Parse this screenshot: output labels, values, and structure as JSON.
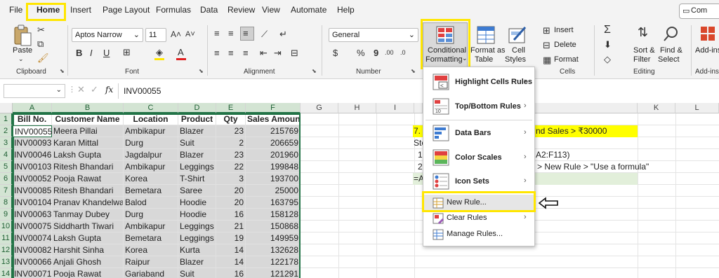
{
  "tabs": [
    "File",
    "Home",
    "Insert",
    "Page Layout",
    "Formulas",
    "Data",
    "Review",
    "View",
    "Automate",
    "Help"
  ],
  "active_tab": "Home",
  "comments_button": "Com",
  "ribbon": {
    "clipboard": {
      "paste": "Paste",
      "group": "Clipboard"
    },
    "font": {
      "name": "Aptos Narrow",
      "size": "11",
      "group": "Font"
    },
    "alignment": {
      "group": "Alignment"
    },
    "number": {
      "format": "General",
      "group": "Number"
    },
    "styles": {
      "conditional_formatting_line1": "Conditional",
      "conditional_formatting_line2": "Formatting",
      "format_as_table_line1": "Format as",
      "format_as_table_line2": "Table",
      "cell_styles_line1": "Cell",
      "cell_styles_line2": "Styles"
    },
    "cells": {
      "insert": "Insert",
      "delete": "Delete",
      "format": "Format",
      "group": "Cells"
    },
    "editing": {
      "sort_filter_line1": "Sort &",
      "sort_filter_line2": "Filter",
      "find_select_line1": "Find &",
      "find_select_line2": "Select",
      "group": "Editing"
    },
    "addins": {
      "label": "Add-ins",
      "group": "Add-ins"
    }
  },
  "formula_bar": {
    "name_box": "",
    "fx": "fx",
    "content": "INV00055"
  },
  "columns": [
    "A",
    "B",
    "C",
    "D",
    "E",
    "F",
    "G",
    "H",
    "I",
    "J",
    "K",
    "L"
  ],
  "rows": [
    "1",
    "2",
    "3",
    "4",
    "5",
    "6",
    "7",
    "8",
    "9",
    "10",
    "11",
    "12",
    "13",
    "14"
  ],
  "table": {
    "headers": [
      "Bill No.",
      "Customer Name",
      "Location",
      "Product",
      "Qty",
      "Sales Amount"
    ],
    "rows": [
      [
        "INV00055",
        "Meera Pillai",
        "Ambikapur",
        "Blazer",
        "23",
        "215769"
      ],
      [
        "INV00093",
        "Karan Mittal",
        "Durg",
        "Suit",
        "2",
        "206659"
      ],
      [
        "INV00046",
        "Laksh Gupta",
        "Jagdalpur",
        "Blazer",
        "23",
        "201960"
      ],
      [
        "INV00103",
        "Ritesh Bhandari",
        "Ambikapur",
        "Leggings",
        "22",
        "199848"
      ],
      [
        "INV00052",
        "Pooja Rawat",
        "Korea",
        "T-Shirt",
        "3",
        "193700"
      ],
      [
        "INV00085",
        "Ritesh Bhandari",
        "Bemetara",
        "Saree",
        "20",
        "25000"
      ],
      [
        "INV00104",
        "Pranav Khandelwal",
        "Balod",
        "Hoodie",
        "20",
        "163795"
      ],
      [
        "INV00063",
        "Tanmay Dubey",
        "Durg",
        "Hoodie",
        "16",
        "158128"
      ],
      [
        "INV00075",
        "Siddharth Tiwari",
        "Ambikapur",
        "Leggings",
        "21",
        "150868"
      ],
      [
        "INV00074",
        "Laksh Gupta",
        "Bemetara",
        "Leggings",
        "19",
        "149959"
      ],
      [
        "INV00082",
        "Harshit Sinha",
        "Korea",
        "Kurta",
        "14",
        "132628"
      ],
      [
        "INV00066",
        "Anjali Ghosh",
        "Raipur",
        "Blazer",
        "14",
        "122178"
      ],
      [
        "INV00071",
        "Pooja Rawat",
        "Gariaband",
        "Suit",
        "16",
        "121291"
      ]
    ]
  },
  "notes": {
    "title_left": "7. H",
    "title_right": "nd Sales > ₹30000",
    "steps_label": "Ste",
    "step1_left": "1.",
    "step1_right": "A2:F113)",
    "step2_left": "2.",
    "step2_right": "> New Rule > \"Use a formula\"",
    "formula_left": "=AI"
  },
  "menu": {
    "items": [
      {
        "label": "Highlight Cells Rules",
        "underline": "H"
      },
      {
        "label": "Top/Bottom Rules",
        "underline": "T"
      },
      {
        "label": "Data Bars",
        "underline": "D"
      },
      {
        "label": "Color Scales",
        "underline": "S"
      },
      {
        "label": "Icon Sets",
        "underline": "I"
      },
      {
        "label": "New Rule...",
        "underline": "N"
      },
      {
        "label": "Clear Rules",
        "underline": "C"
      },
      {
        "label": "Manage Rules...",
        "underline": "R"
      }
    ]
  },
  "colors": {
    "highlight": "#ffe600",
    "excel_green": "#217346",
    "note_yellow": "#ffff00",
    "note_green": "#e2efda"
  }
}
